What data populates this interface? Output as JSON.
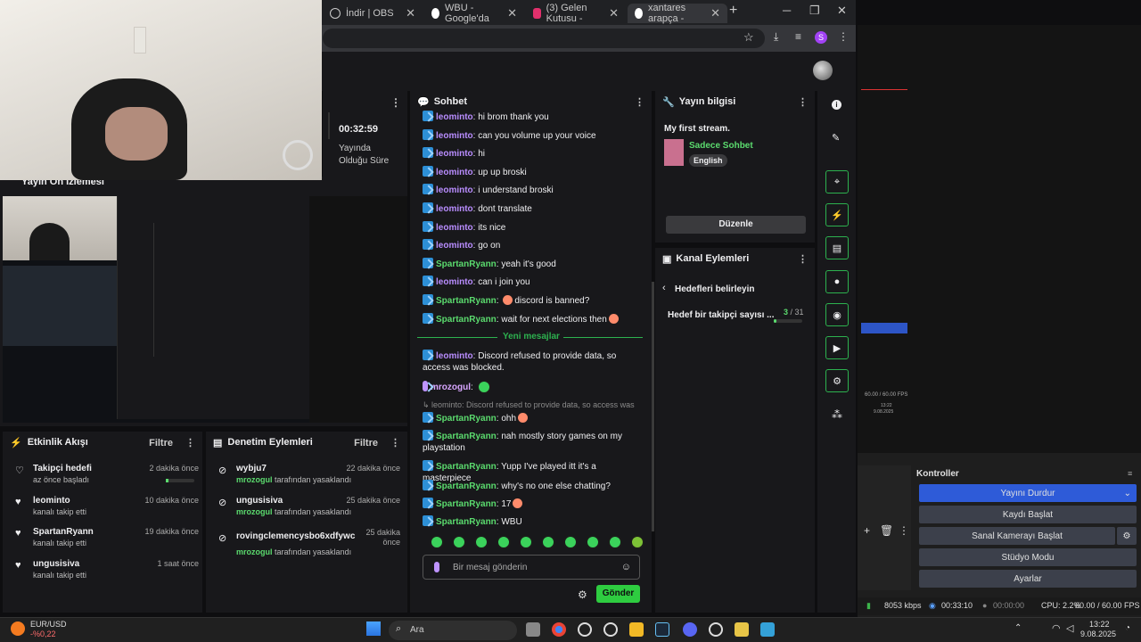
{
  "browser": {
    "tabs": [
      {
        "label": "İndir | OBS",
        "color": "#444"
      },
      {
        "label": "WBU - Google'da",
        "color": "#4285f4"
      },
      {
        "label": "(3) Gelen Kutusu -",
        "color": "#e1306c"
      },
      {
        "label": "xantares arapça -",
        "color": "#4285f4"
      }
    ],
    "profile_letter": "S"
  },
  "stream_stats": {
    "uptime": "00:32:59",
    "uptime_label_1": "Yayında",
    "uptime_label_2": "Olduğu Süre"
  },
  "preview": {
    "title": "Yayın Ön İzlemesi"
  },
  "chat": {
    "title": "Sohbet",
    "messages": [
      {
        "user": "leominto",
        "text": ": hi brom thank you",
        "cls": "u1"
      },
      {
        "user": "leominto",
        "text": ": can you volume up your voice",
        "cls": "u1"
      },
      {
        "user": "leominto",
        "text": ": hi",
        "cls": "u1"
      },
      {
        "user": "leominto",
        "text": ": up up broski",
        "cls": "u1"
      },
      {
        "user": "leominto",
        "text": ": i understand broski",
        "cls": "u1"
      },
      {
        "user": "leominto",
        "text": ": dont translate",
        "cls": "u1"
      },
      {
        "user": "leominto",
        "text": ": its nice",
        "cls": "u1"
      },
      {
        "user": "leominto",
        "text": ": go on",
        "cls": "u1"
      },
      {
        "user": "SpartanRyann",
        "text": ": yeah it's good",
        "cls": "u2"
      },
      {
        "user": "leominto",
        "text": ": can i join you",
        "cls": "u1"
      },
      {
        "user": "SpartanRyann",
        "text": ": discord is banned?",
        "cls": "u2",
        "emoji_before": true
      },
      {
        "user": "SpartanRyann",
        "text": ": wait for next elections then",
        "cls": "u2",
        "emoji_after": true
      }
    ],
    "new_messages_label": "Yeni mesajlar",
    "after": [
      {
        "user": "leominto",
        "text": ": Discord refused to provide data, so access was blocked.",
        "cls": "u1"
      },
      {
        "user": "mrozogul",
        "text": ":",
        "cls": "u3",
        "emote": true
      },
      {
        "reply": "leominto: Discord refused to provide data, so access was ..."
      },
      {
        "user": "SpartanRyann",
        "text": ": ohh",
        "cls": "u2",
        "emoji_after": true
      },
      {
        "user": "SpartanRyann",
        "text": ": nah mostly story games on my playstation",
        "cls": "u2"
      },
      {
        "user": "SpartanRyann",
        "text": ": Yupp I've played itt it's a masterpiece",
        "cls": "u2"
      },
      {
        "user": "SpartanRyann",
        "text": ": why's no one else chatting?",
        "cls": "u2"
      },
      {
        "user": "SpartanRyann",
        "text": ": 17",
        "cls": "u2",
        "emoji_after": true
      },
      {
        "user": "SpartanRyann",
        "text": ": WBU",
        "cls": "u2"
      }
    ],
    "input_placeholder": "Bir mesaj gönderin",
    "send_label": "Gönder"
  },
  "stream_info": {
    "title": "Yayın bilgisi",
    "stream_title": "My first stream.",
    "category": "Sadece Sohbet",
    "language": "English",
    "edit_label": "Düzenle"
  },
  "channel_actions": {
    "title": "Kanal Eylemleri",
    "goal_link": "Hedefleri belirleyin",
    "goal_label": "Hedef bir takipçi sayısı ...",
    "goal_current": "3",
    "goal_total": "/ 31",
    "goal_fraction": 0.097
  },
  "activity_feed": {
    "title": "Etkinlik Akışı",
    "filter": "Filtre",
    "items": [
      {
        "name": "Takipçi hedefi",
        "sub": "az önce başladı",
        "time": "2 dakika önce"
      },
      {
        "name": "leominto",
        "sub": "kanalı takip etti",
        "time": "10 dakika önce"
      },
      {
        "name": "SpartanRyann",
        "sub": "kanalı takip etti",
        "time": "19 dakika önce"
      },
      {
        "name": "ungusisiva",
        "sub": "kanalı takip etti",
        "time": "1 saat önce"
      }
    ]
  },
  "mod_actions": {
    "title": "Denetim Eylemleri",
    "filter": "Filtre",
    "items": [
      {
        "name": "wybju7",
        "mod": "mrozogul",
        "sub": "tarafından yasaklandı",
        "time": "22 dakika önce"
      },
      {
        "name": "ungusisiva",
        "mod": "mrozogul",
        "sub": "tarafından yasaklandı",
        "time": "25 dakika önce"
      },
      {
        "name": "rovingclemencysbo6xdfywc",
        "mod": "mrozogul",
        "sub": "tarafından yasaklandı",
        "time_1": "25 dakika",
        "time_2": "önce"
      }
    ]
  },
  "obs": {
    "controls_title": "Kontroller",
    "buttons": [
      "Yayını Durdur",
      "Kaydı Başlat",
      "Sanal Kamerayı Başlat",
      "Stüdyo Modu",
      "Ayarlar"
    ],
    "mini_fps": "60.00 / 60.00 FPS",
    "mini_time": "13:22",
    "mini_date": "9.08.2025",
    "status": {
      "bitrate": "8053 kbps",
      "stream_time": "00:33:10",
      "rec_time": "00:00:00",
      "cpu": "CPU: 2.2%",
      "fps": "60.00 / 60.00 FPS"
    }
  },
  "taskbar": {
    "currency": "EUR/USD",
    "change": "-%0,22",
    "search": "Ara",
    "time": "13:22",
    "date": "9.08.2025"
  }
}
